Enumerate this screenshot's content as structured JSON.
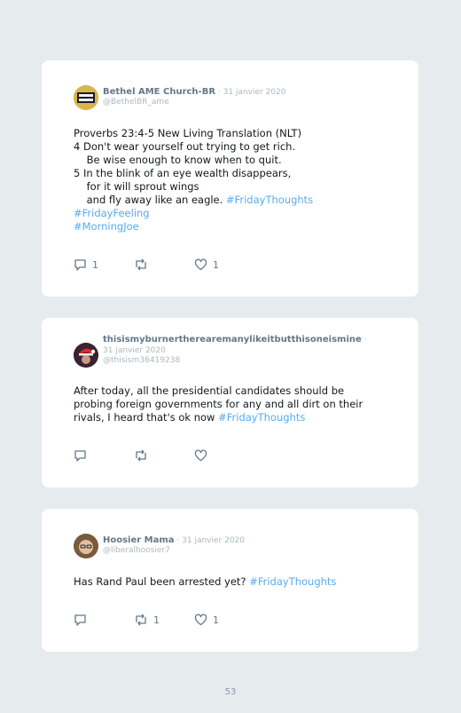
{
  "tweets": [
    {
      "name": "Bethel AME Church-BR",
      "date": " · 31 janvier 2020",
      "handle": "@BethelBR_ame",
      "text": "Proverbs 23:4-5 New Living Translation (NLT)\n4 Don't wear yourself out trying to get rich.\n    Be wise enough to know when to quit.\n5 In the blink of an eye wealth disappears,\n    for it will sprout wings\n    and fly away like an eagle. ",
      "hashtags": [
        "#FridayThoughts",
        "#FridayFeeling",
        "#MorningJoe"
      ],
      "replies": "1",
      "retweets": "",
      "likes": "1",
      "avatar_text": "I AM NO ONE"
    },
    {
      "name": "thisismyburnertherearemanylikeitbutthisoneismine",
      "date": " · 31 janvier 2020",
      "handle": "@thisism36419238",
      "text": "After today, all the presidential candidates should be probing foreign governments for any and all dirt on their rivals, I heard that's ok now ",
      "hashtags": [
        "#FridayThoughts"
      ],
      "replies": "",
      "retweets": "",
      "likes": ""
    },
    {
      "name": "Hoosier Mama",
      "date": " · 31 janvier 2020",
      "handle": "@liberalhoosier7",
      "text": "Has Rand Paul been arrested yet? ",
      "hashtags": [
        "#FridayThoughts"
      ],
      "replies": "",
      "retweets": "1",
      "likes": "1"
    }
  ],
  "page_number": "53",
  "colors": {
    "background": "#e6ebee",
    "card": "#ffffff",
    "hashtag": "#55acee",
    "meta": "#aab8c2"
  }
}
